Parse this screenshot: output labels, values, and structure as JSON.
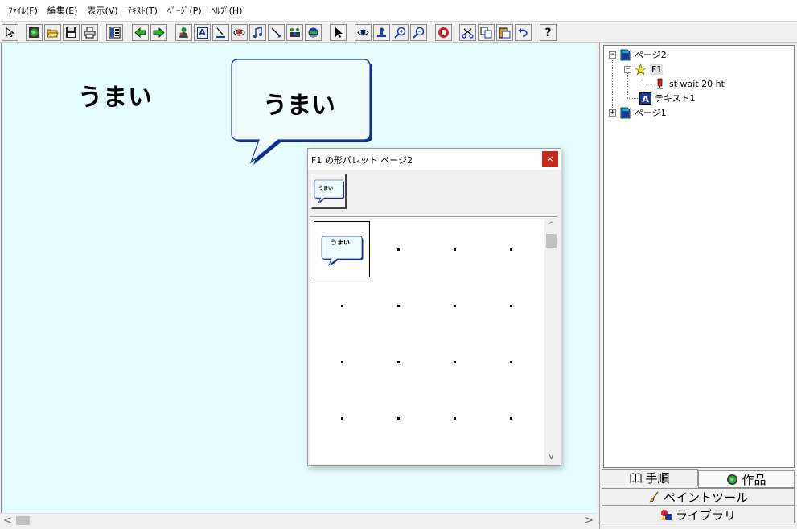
{
  "menu": [
    "ﾌｧｲﾙ(F)",
    "編集(E)",
    "表示(V)",
    "ﾃｷｽﾄ(T)",
    "ﾍﾟｰｼﾞ(P)",
    "ﾍﾙﾌﾟ(H)"
  ],
  "toolbar": {
    "help_glyph": "?",
    "text_tool_glyph": "A",
    "icons": [
      "arrow-cursor-icon",
      "globe-icon",
      "open-folder-icon",
      "save-disk-icon",
      "print-icon",
      "layout-icon",
      "back-arrow-icon",
      "forward-arrow-icon",
      "character-icon",
      "text-tool-icon",
      "paint-icon",
      "lips-icon",
      "music-note-icon",
      "wand-icon",
      "people-icon",
      "face-icon",
      "pointer-icon",
      "eye-icon",
      "stamp-icon",
      "zoom-in-icon",
      "zoom-out-icon",
      "stop-hand-icon",
      "cut-icon",
      "copy-icon",
      "paste-icon",
      "undo-icon",
      "help-icon"
    ]
  },
  "canvas": {
    "background": "#e6fdfe",
    "text": "うまい",
    "bubble_text": "うまい"
  },
  "tree": {
    "nodes": [
      {
        "label": "ページ2",
        "expander": "−",
        "icon": "page-icon"
      },
      {
        "label": "F1",
        "expander": "−",
        "icon": "star-character-icon"
      },
      {
        "label": "st wait 20 ht",
        "icon": "pin-icon"
      },
      {
        "label": "テキスト1",
        "icon": "text-a-icon",
        "icon_glyph": "A"
      },
      {
        "label": "ページ1",
        "expander": "+",
        "icon": "page-icon"
      }
    ]
  },
  "panel_tabs": {
    "steps": "手順",
    "works": "作品",
    "paint_tool": "ペイントツール",
    "library": "ライブラリ"
  },
  "palette": {
    "title": "F1 の形パレット ページ2",
    "close": "×",
    "preview_text": "うまい",
    "selected_cell_text": "うまい",
    "scroll_up": "^",
    "scroll_down": "v"
  },
  "scroll": {
    "left": "<",
    "right": ">"
  }
}
